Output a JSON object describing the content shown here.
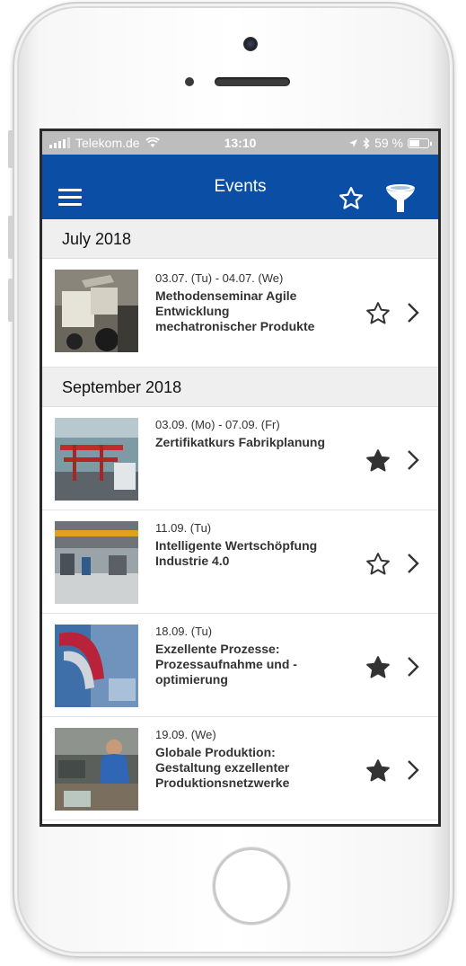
{
  "status_bar": {
    "carrier": "Telekom.de",
    "time": "13:10",
    "battery": "59 %",
    "battery_level": 0.59
  },
  "app_bar": {
    "title": "Events",
    "menu_icon": "hamburger-icon",
    "favorites_icon": "star-outline-icon",
    "filter_icon": "funnel-icon"
  },
  "colors": {
    "primary": "#0a4fa5",
    "status_bar": "#bdbdbd",
    "section_bg": "#efefef",
    "star": "#333333"
  },
  "sections": [
    {
      "title": "July 2018",
      "events": [
        {
          "date": "03.07. (Tu) - 04.07. (We)",
          "title": "Methodenseminar Agile Entwicklung mechatronischer Produkte",
          "favorite": false
        }
      ]
    },
    {
      "title": "September 2018",
      "events": [
        {
          "date": "03.09. (Mo) - 07.09. (Fr)",
          "title": "Zertifikatkurs Fabrikplanung",
          "favorite": true
        },
        {
          "date": "11.09. (Tu)",
          "title": "Intelligente Wertschöpfung Industrie 4.0",
          "favorite": false
        },
        {
          "date": "18.09. (Tu)",
          "title": "Exzellente Prozesse: Prozessaufnahme und -optimierung",
          "favorite": true
        },
        {
          "date": "19.09. (We)",
          "title": "Globale Produktion: Gestaltung exzellenter Produktionsnetzwerke",
          "favorite": true
        }
      ]
    }
  ]
}
